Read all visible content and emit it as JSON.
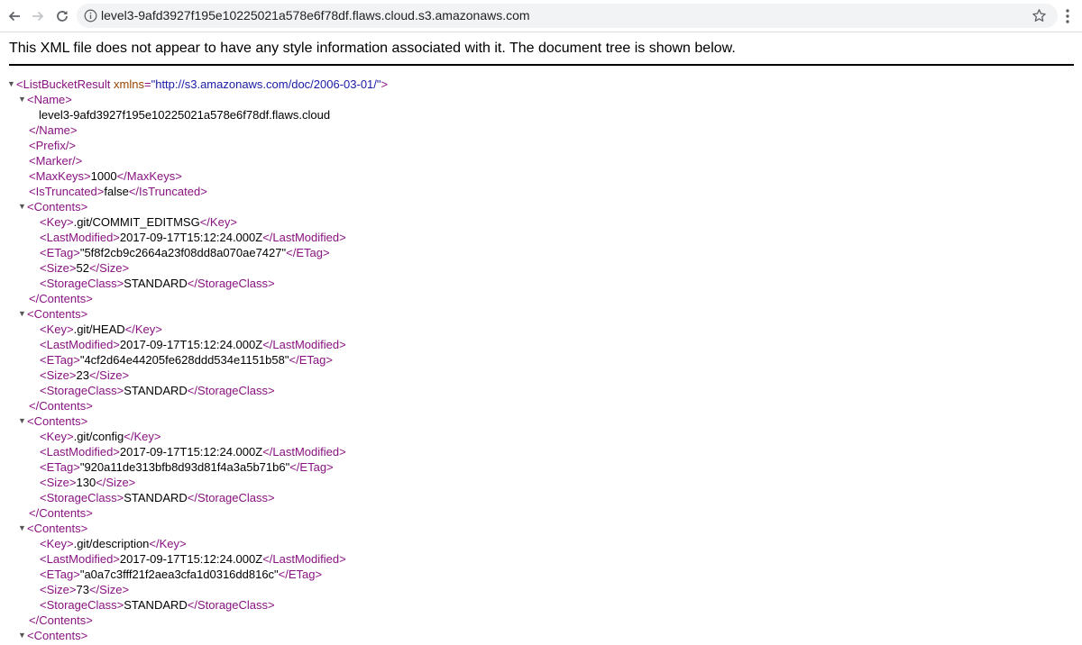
{
  "browser": {
    "url": "level3-9afd3927f195e10225021a578e6f78df.flaws.cloud.s3.amazonaws.com",
    "icons": [
      "back-arrow-icon",
      "forward-arrow-icon",
      "reload-icon",
      "info-icon",
      "star-icon",
      "kebab-menu-icon"
    ]
  },
  "page": {
    "notice": "This XML file does not appear to have any style information associated with it. The document tree is shown below."
  },
  "xml": {
    "root_open": "<ListBucketResult",
    "root_attr_name": "xmlns",
    "root_attr_value": "\"http://s3.amazonaws.com/doc/2006-03-01/\"",
    "root_close_bracket": ">",
    "name_open": "<Name>",
    "name_value": "level3-9afd3927f195e10225021a578e6f78df.flaws.cloud",
    "name_close": "</Name>",
    "prefix": "<Prefix/>",
    "marker": "<Marker/>",
    "maxkeys": {
      "open": "<MaxKeys>",
      "value": "1000",
      "close": "</MaxKeys>"
    },
    "istruncated": {
      "open": "<IsTruncated>",
      "value": "false",
      "close": "</IsTruncated>"
    },
    "contents_open": "<Contents>",
    "contents_close": "</Contents>",
    "tags": {
      "key_open": "<Key>",
      "key_close": "</Key>",
      "lm_open": "<LastModified>",
      "lm_close": "</LastModified>",
      "etag_open": "<ETag>",
      "etag_close": "</ETag>",
      "size_open": "<Size>",
      "size_close": "</Size>",
      "sc_open": "<StorageClass>",
      "sc_close": "</StorageClass>"
    },
    "contents": [
      {
        "key": ".git/COMMIT_EDITMSG",
        "last_modified": "2017-09-17T15:12:24.000Z",
        "etag": "\"5f8f2cb9c2664a23f08dd8a070ae7427\"",
        "size": "52",
        "storage_class": "STANDARD"
      },
      {
        "key": ".git/HEAD",
        "last_modified": "2017-09-17T15:12:24.000Z",
        "etag": "\"4cf2d64e44205fe628ddd534e1151b58\"",
        "size": "23",
        "storage_class": "STANDARD"
      },
      {
        "key": ".git/config",
        "last_modified": "2017-09-17T15:12:24.000Z",
        "etag": "\"920a11de313bfb8d93d81f4a3a5b71b6\"",
        "size": "130",
        "storage_class": "STANDARD"
      },
      {
        "key": ".git/description",
        "last_modified": "2017-09-17T15:12:24.000Z",
        "etag": "\"a0a7c3fff21f2aea3cfa1d0316dd816c\"",
        "size": "73",
        "storage_class": "STANDARD"
      }
    ],
    "twisty": "▼"
  },
  "colors": {
    "tag": "#881280",
    "attr_name": "#994500",
    "attr_value": "#1a1aa6"
  }
}
